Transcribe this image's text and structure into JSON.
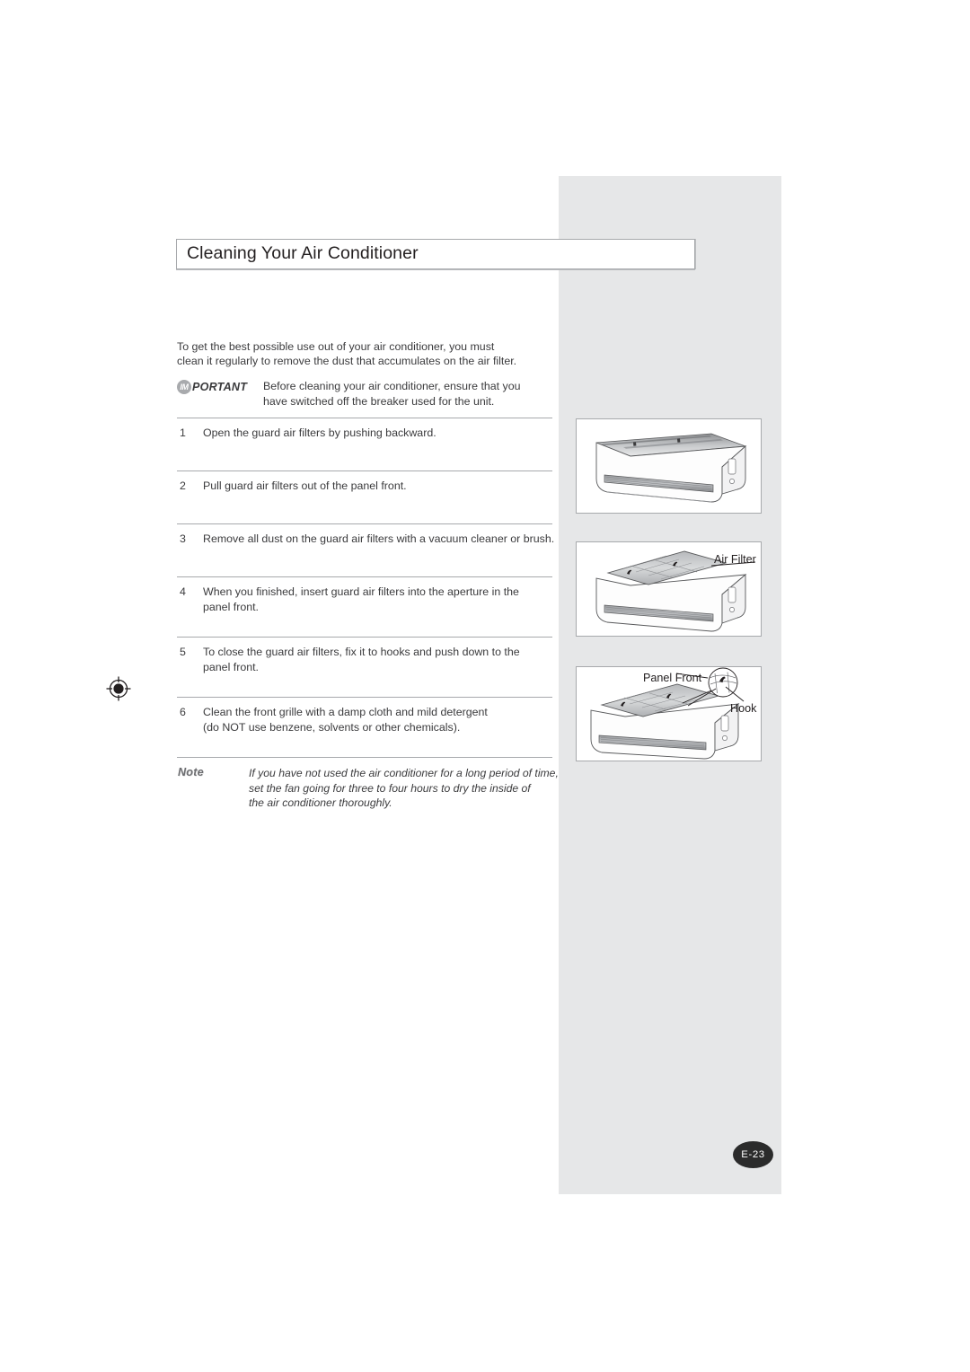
{
  "page": {
    "title": "Cleaning Your Air Conditioner",
    "page_number": "E-23"
  },
  "intro": {
    "line1": "To get the best possible use out of your air conditioner, you must",
    "line2": "clean it regularly to remove the dust that accumulates on the air filter."
  },
  "important": {
    "badge": "IM",
    "label": "PORTANT",
    "line1": "Before cleaning your air conditioner, ensure that you",
    "line2": "have switched off the breaker used for the unit."
  },
  "steps": [
    {
      "number": "1",
      "line1": "Open the guard air filters by pushing backward.",
      "line2": ""
    },
    {
      "number": "2",
      "line1": "Pull guard air filters out of the panel front.",
      "line2": ""
    },
    {
      "number": "3",
      "line1": "Remove all dust on the guard air filters with a vacuum cleaner or brush.",
      "line2": ""
    },
    {
      "number": "4",
      "line1": "When you finished, insert guard air filters into the aperture in the",
      "line2": "panel front."
    },
    {
      "number": "5",
      "line1": "To close the guard air filters, fix it to hooks and push down to the",
      "line2": "panel front."
    },
    {
      "number": "6",
      "line1": "Clean the front grille with a damp cloth and mild detergent",
      "line2": "(do NOT use benzene, solvents or other chemicals)."
    }
  ],
  "note": {
    "label": "Note",
    "line1": "If you have not used the air conditioner for a long period of time,",
    "line2": "set the fan going for three to four hours to dry the inside of",
    "line3": "the air conditioner thoroughly."
  },
  "illustrations": {
    "labels": {
      "air_filter": "Air Filter",
      "panel_front": "Panel Front",
      "hook": "Hook"
    }
  },
  "colors": {
    "side_panel": "#e6e7e8",
    "rule": "#a7a9ac",
    "text": "#3b3b3d",
    "badge": "#2b2b2b"
  }
}
